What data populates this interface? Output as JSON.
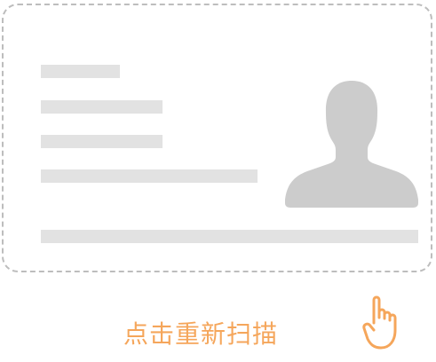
{
  "actions": {
    "rescan_label": "点击重新扫描"
  },
  "icons": {
    "avatar": "person-silhouette-icon",
    "tap": "tap-hand-icon"
  },
  "colors": {
    "border": "#bdbdbd",
    "placeholder": "#e2e2e2",
    "avatar": "#cccccc",
    "accent": "#f5a65b"
  }
}
